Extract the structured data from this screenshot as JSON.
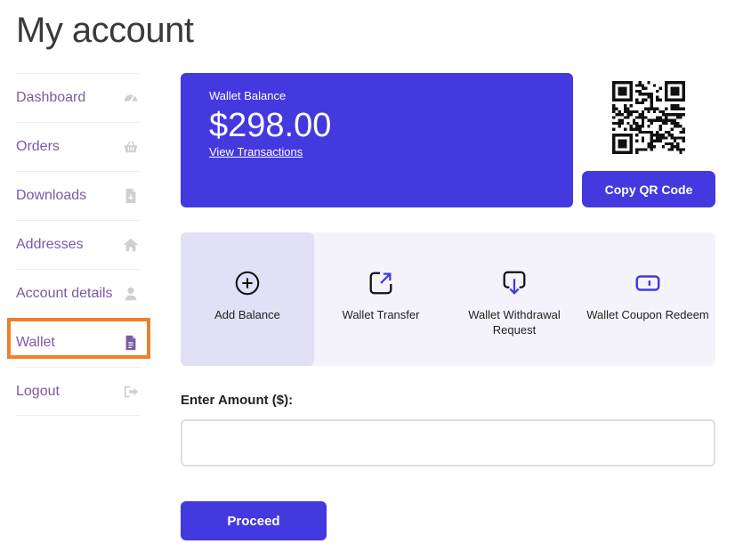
{
  "page": {
    "title": "My account"
  },
  "sidebar": {
    "items": [
      {
        "label": "Dashboard",
        "icon": "dashboard-icon"
      },
      {
        "label": "Orders",
        "icon": "basket-icon"
      },
      {
        "label": "Downloads",
        "icon": "file-download-icon"
      },
      {
        "label": "Addresses",
        "icon": "home-icon"
      },
      {
        "label": "Account details",
        "icon": "user-icon"
      },
      {
        "label": "Wallet",
        "icon": "document-icon",
        "active": true
      },
      {
        "label": "Logout",
        "icon": "sign-out-icon"
      }
    ]
  },
  "wallet": {
    "balance_label": "Wallet Balance",
    "balance_amount": "$298.00",
    "view_transactions": "View Transactions",
    "copy_qr_label": "Copy QR Code"
  },
  "actions": [
    {
      "label": "Add Balance",
      "icon": "plus-circle-icon",
      "selected": true
    },
    {
      "label": "Wallet Transfer",
      "icon": "transfer-icon"
    },
    {
      "label": "Wallet Withdrawal Request",
      "icon": "withdraw-icon"
    },
    {
      "label": "Wallet Coupon Redeem",
      "icon": "coupon-icon"
    }
  ],
  "amount_form": {
    "label": "Enter Amount ($):",
    "value": "",
    "proceed_label": "Proceed"
  },
  "colors": {
    "primary": "#4438df",
    "nav_text": "#7a5aa6",
    "active_outline": "#ef7f2c",
    "actions_bg": "#f4f3fc"
  }
}
